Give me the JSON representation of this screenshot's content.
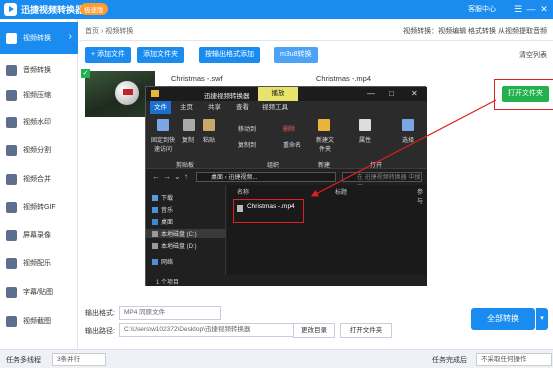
{
  "app": {
    "title": "迅捷视频转换器",
    "badge": "极速版",
    "support": "客服中心",
    "controls": [
      "☰",
      "—",
      "✕"
    ]
  },
  "sidebar": {
    "items": [
      {
        "label": "视频转换",
        "active": true
      },
      {
        "label": "音频转换"
      },
      {
        "label": "视频压缩"
      },
      {
        "label": "视频水印"
      },
      {
        "label": "视频分割"
      },
      {
        "label": "视频合并"
      },
      {
        "label": "视频转GIF"
      },
      {
        "label": "屏幕录像"
      },
      {
        "label": "视频配乐"
      },
      {
        "label": "字幕/贴图"
      },
      {
        "label": "视频截图"
      }
    ]
  },
  "breadcrumb": {
    "home": "首页",
    "sep": "›",
    "current": "视频转换"
  },
  "toplinks": "视频转换：视频编辑 格式转换 从视频提取音频",
  "toolbar": {
    "add_file": "+ 添加文件",
    "add_folder": "添加文件夹",
    "batch_add": "按输出格式添加",
    "m3u8": "m3u8转换",
    "clear": "清空列表"
  },
  "file": {
    "name_left": "Christmas -.swf",
    "name_right": "Christmas -.mp4",
    "open_folder": "打开文件夹"
  },
  "explorer": {
    "title": "迅捷视频转换器",
    "play_tab": "播放",
    "tabs": [
      "文件",
      "主页",
      "共享",
      "查看",
      "视频工具"
    ],
    "ribbon": {
      "pin": "固定到快速访问",
      "copy": "复制",
      "paste": "粘贴",
      "move_to": "移动到",
      "copy_to": "复制到",
      "delete": "删除",
      "rename": "重命名",
      "new_folder": "新建文件夹",
      "properties": "属性",
      "select": "选择",
      "group_clipboard": "剪贴板",
      "group_organize": "组织",
      "group_new": "新建",
      "group_open": "打开"
    },
    "path": "桌面 › 迅捷视频...",
    "search_placeholder": "在 迅捷视频转换器 中搜索",
    "nav": [
      "下载",
      "音乐",
      "桌面",
      "本地磁盘 (C:)",
      "本地磁盘 (D:)",
      "网络"
    ],
    "columns": [
      "名称",
      "标题",
      "参与"
    ],
    "file": "Christmas -.mp4",
    "status": "1 个项目"
  },
  "bottom": {
    "format_label": "输出格式:",
    "format_value": "MP4  同原文件",
    "path_label": "输出路径:",
    "path_value": "C:\\Users\\w102372\\Desktop\\迅捷视频转换器",
    "change_dir": "更改目录",
    "open_folder": "打开文件夹",
    "convert_all": "全部转换"
  },
  "statusbar": {
    "thread_label": "任务多线程",
    "thread_value": "3条并行",
    "after_label": "任务完成后",
    "after_value": "不采取任何操作"
  },
  "colors": {
    "accent": "#1a8cf0",
    "green": "#22b14c",
    "red": "#e02020"
  }
}
